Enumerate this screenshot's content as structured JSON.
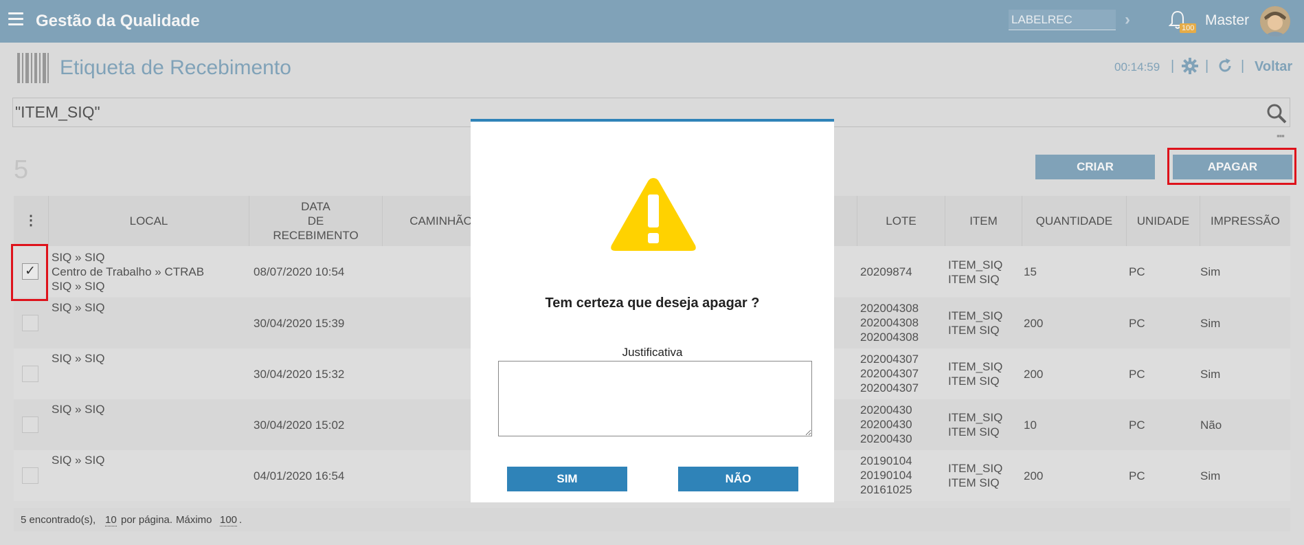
{
  "header": {
    "app_title": "Gestão da Qualidade",
    "code_value": "LABELREC",
    "notification_count": "100",
    "user_name": "Master"
  },
  "page": {
    "title": "Etiqueta de Recebimento",
    "timer": "00:14:59",
    "back_label": "Voltar"
  },
  "search": {
    "value": "\"ITEM_SIQ\""
  },
  "toolbar": {
    "record_count": "5",
    "create_label": "CRIAR",
    "delete_label": "APAGAR"
  },
  "table": {
    "columns": {
      "local": "LOCAL",
      "data_l1": "DATA",
      "data_l2": "DE",
      "data_l3": "RECEBIMENTO",
      "caminhao": "CAMINHÃO",
      "lote": "LOTE",
      "item": "ITEM",
      "quantidade": "QUANTIDADE",
      "unidade": "UNIDADE",
      "impressao": "IMPRESSÃO"
    },
    "rows": [
      {
        "checked": true,
        "local": [
          "SIQ » SIQ",
          "Centro de Trabalho » CTRAB",
          "SIQ » SIQ"
        ],
        "date": "08/07/2020 10:54",
        "lote": [
          "20209874"
        ],
        "item": [
          "ITEM_SIQ",
          "ITEM SIQ"
        ],
        "qty": "15",
        "unit": "PC",
        "print": "Sim"
      },
      {
        "checked": false,
        "local": [
          "SIQ » SIQ"
        ],
        "date": "30/04/2020 15:39",
        "lote": [
          "202004308",
          "202004308",
          "202004308"
        ],
        "item": [
          "ITEM_SIQ",
          "ITEM SIQ"
        ],
        "qty": "200",
        "unit": "PC",
        "print": "Sim"
      },
      {
        "checked": false,
        "local": [
          "SIQ » SIQ"
        ],
        "date": "30/04/2020 15:32",
        "lote": [
          "202004307",
          "202004307",
          "202004307"
        ],
        "item": [
          "ITEM_SIQ",
          "ITEM SIQ"
        ],
        "qty": "200",
        "unit": "PC",
        "print": "Sim"
      },
      {
        "checked": false,
        "local": [
          "SIQ » SIQ"
        ],
        "date": "30/04/2020 15:02",
        "lote": [
          "20200430",
          "20200430",
          "20200430"
        ],
        "item": [
          "ITEM_SIQ",
          "ITEM SIQ"
        ],
        "qty": "10",
        "unit": "PC",
        "print": "Não"
      },
      {
        "checked": false,
        "local": [
          "SIQ » SIQ"
        ],
        "date": "04/01/2020 16:54",
        "lote": [
          "20190104",
          "20190104",
          "20161025"
        ],
        "item": [
          "ITEM_SIQ",
          "ITEM SIQ"
        ],
        "qty": "200",
        "unit": "PC",
        "print": "Sim"
      }
    ]
  },
  "footer": {
    "found": "5 encontrado(s),",
    "per_page": "10",
    "per_page_label": "por página.",
    "max_label": "Máximo",
    "max": "100",
    "end": "."
  },
  "dialog": {
    "question": "Tem certeza que deseja apagar ?",
    "justification_label": "Justificativa",
    "yes_label": "SIM",
    "no_label": "NÃO"
  },
  "colors": {
    "header_bg": "#86a9c0",
    "dialog_button": "#2f83b8",
    "highlight": "#e8131d",
    "warning": "#ffd200"
  }
}
